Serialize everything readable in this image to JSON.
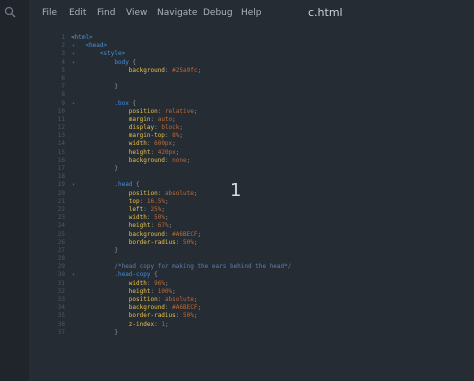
{
  "menu": {
    "file": "File",
    "edit": "Edit",
    "find": "Find",
    "view": "View",
    "navigate": "Navigate",
    "debug": "Debug",
    "help": "Help"
  },
  "document": {
    "title": "c.html"
  },
  "cursor_number": "1",
  "icons": {
    "sidebar": "search-icon"
  },
  "colors": {
    "background": "#262c33",
    "tag": "#4c8fd1",
    "property": "#e6c24a",
    "value": "#bf6a36"
  },
  "lines": [
    {
      "no": "1",
      "fold": "▾",
      "tokens": [
        {
          "c": "tag",
          "t": "<html>"
        }
      ]
    },
    {
      "no": "2",
      "fold": "▾",
      "tokens": [
        {
          "c": "pun",
          "t": "    "
        },
        {
          "c": "tag",
          "t": "<head>"
        }
      ]
    },
    {
      "no": "3",
      "fold": "▾",
      "tokens": [
        {
          "c": "pun",
          "t": "        "
        },
        {
          "c": "tag",
          "t": "<style>"
        }
      ]
    },
    {
      "no": "4",
      "fold": "▾",
      "tokens": [
        {
          "c": "pun",
          "t": "            "
        },
        {
          "c": "sel",
          "t": "body"
        },
        {
          "c": "pun",
          "t": " {"
        }
      ]
    },
    {
      "no": "5",
      "fold": "",
      "tokens": [
        {
          "c": "pun",
          "t": "                "
        },
        {
          "c": "prop",
          "t": "background"
        },
        {
          "c": "pun",
          "t": ": "
        },
        {
          "c": "val",
          "t": "#25a9fc"
        },
        {
          "c": "pun",
          "t": ";"
        }
      ]
    },
    {
      "no": "6",
      "fold": "",
      "tokens": [
        {
          "c": "pun",
          "t": ""
        }
      ]
    },
    {
      "no": "7",
      "fold": "",
      "tokens": [
        {
          "c": "pun",
          "t": "            }"
        }
      ]
    },
    {
      "no": "8",
      "fold": "",
      "tokens": [
        {
          "c": "pun",
          "t": ""
        }
      ]
    },
    {
      "no": "9",
      "fold": "▾",
      "tokens": [
        {
          "c": "pun",
          "t": "            "
        },
        {
          "c": "sel",
          "t": ".box"
        },
        {
          "c": "pun",
          "t": " {"
        }
      ]
    },
    {
      "no": "10",
      "fold": "",
      "tokens": [
        {
          "c": "pun",
          "t": "                "
        },
        {
          "c": "prop",
          "t": "position"
        },
        {
          "c": "pun",
          "t": ": "
        },
        {
          "c": "val",
          "t": "relative"
        },
        {
          "c": "pun",
          "t": ";"
        }
      ]
    },
    {
      "no": "11",
      "fold": "",
      "tokens": [
        {
          "c": "pun",
          "t": "                "
        },
        {
          "c": "prop",
          "t": "margin"
        },
        {
          "c": "pun",
          "t": ": "
        },
        {
          "c": "val",
          "t": "auto"
        },
        {
          "c": "pun",
          "t": ";"
        }
      ]
    },
    {
      "no": "12",
      "fold": "",
      "tokens": [
        {
          "c": "pun",
          "t": "                "
        },
        {
          "c": "prop",
          "t": "display"
        },
        {
          "c": "pun",
          "t": ": "
        },
        {
          "c": "val",
          "t": "block"
        },
        {
          "c": "pun",
          "t": ";"
        }
      ]
    },
    {
      "no": "13",
      "fold": "",
      "tokens": [
        {
          "c": "pun",
          "t": "                "
        },
        {
          "c": "prop",
          "t": "margin-top"
        },
        {
          "c": "pun",
          "t": ": "
        },
        {
          "c": "val",
          "t": "8%"
        },
        {
          "c": "pun",
          "t": ";"
        }
      ]
    },
    {
      "no": "14",
      "fold": "",
      "tokens": [
        {
          "c": "pun",
          "t": "                "
        },
        {
          "c": "prop",
          "t": "width"
        },
        {
          "c": "pun",
          "t": ": "
        },
        {
          "c": "val",
          "t": "600px"
        },
        {
          "c": "pun",
          "t": ";"
        }
      ]
    },
    {
      "no": "15",
      "fold": "",
      "tokens": [
        {
          "c": "pun",
          "t": "                "
        },
        {
          "c": "prop",
          "t": "height"
        },
        {
          "c": "pun",
          "t": ": "
        },
        {
          "c": "val",
          "t": "420px"
        },
        {
          "c": "pun",
          "t": ";"
        }
      ]
    },
    {
      "no": "16",
      "fold": "",
      "tokens": [
        {
          "c": "pun",
          "t": "                "
        },
        {
          "c": "prop",
          "t": "background"
        },
        {
          "c": "pun",
          "t": ": "
        },
        {
          "c": "val",
          "t": "none"
        },
        {
          "c": "pun",
          "t": ";"
        }
      ]
    },
    {
      "no": "17",
      "fold": "",
      "tokens": [
        {
          "c": "pun",
          "t": "            }"
        }
      ]
    },
    {
      "no": "18",
      "fold": "",
      "tokens": [
        {
          "c": "pun",
          "t": ""
        }
      ]
    },
    {
      "no": "19",
      "fold": "▾",
      "tokens": [
        {
          "c": "pun",
          "t": "            "
        },
        {
          "c": "sel",
          "t": ".head"
        },
        {
          "c": "pun",
          "t": " {"
        }
      ]
    },
    {
      "no": "20",
      "fold": "",
      "tokens": [
        {
          "c": "pun",
          "t": "                "
        },
        {
          "c": "prop",
          "t": "position"
        },
        {
          "c": "pun",
          "t": ": "
        },
        {
          "c": "val",
          "t": "absolute"
        },
        {
          "c": "pun",
          "t": ";"
        }
      ]
    },
    {
      "no": "21",
      "fold": "",
      "tokens": [
        {
          "c": "pun",
          "t": "                "
        },
        {
          "c": "prop",
          "t": "top"
        },
        {
          "c": "pun",
          "t": ": "
        },
        {
          "c": "val",
          "t": "16.5%"
        },
        {
          "c": "pun",
          "t": ";"
        }
      ]
    },
    {
      "no": "22",
      "fold": "",
      "tokens": [
        {
          "c": "pun",
          "t": "                "
        },
        {
          "c": "prop",
          "t": "left"
        },
        {
          "c": "pun",
          "t": ": "
        },
        {
          "c": "val",
          "t": "25%"
        },
        {
          "c": "pun",
          "t": ";"
        }
      ]
    },
    {
      "no": "23",
      "fold": "",
      "tokens": [
        {
          "c": "pun",
          "t": "                "
        },
        {
          "c": "prop",
          "t": "width"
        },
        {
          "c": "pun",
          "t": ": "
        },
        {
          "c": "val",
          "t": "50%"
        },
        {
          "c": "pun",
          "t": ";"
        }
      ]
    },
    {
      "no": "24",
      "fold": "",
      "tokens": [
        {
          "c": "pun",
          "t": "                "
        },
        {
          "c": "prop",
          "t": "height"
        },
        {
          "c": "pun",
          "t": ": "
        },
        {
          "c": "val",
          "t": "67%"
        },
        {
          "c": "pun",
          "t": ";"
        }
      ]
    },
    {
      "no": "25",
      "fold": "",
      "tokens": [
        {
          "c": "pun",
          "t": "                "
        },
        {
          "c": "prop",
          "t": "background"
        },
        {
          "c": "pun",
          "t": ": "
        },
        {
          "c": "val",
          "t": "#A6BECF"
        },
        {
          "c": "pun",
          "t": ";"
        }
      ]
    },
    {
      "no": "26",
      "fold": "",
      "tokens": [
        {
          "c": "pun",
          "t": "                "
        },
        {
          "c": "prop",
          "t": "border-radius"
        },
        {
          "c": "pun",
          "t": ": "
        },
        {
          "c": "val",
          "t": "50%"
        },
        {
          "c": "pun",
          "t": ";"
        }
      ]
    },
    {
      "no": "27",
      "fold": "",
      "tokens": [
        {
          "c": "pun",
          "t": "            }"
        }
      ]
    },
    {
      "no": "28",
      "fold": "",
      "tokens": [
        {
          "c": "pun",
          "t": ""
        }
      ]
    },
    {
      "no": "29",
      "fold": "",
      "tokens": [
        {
          "c": "pun",
          "t": "            "
        },
        {
          "c": "com",
          "t": "/*head copy for making the ears behind the head*/"
        }
      ]
    },
    {
      "no": "30",
      "fold": "▾",
      "tokens": [
        {
          "c": "pun",
          "t": "            "
        },
        {
          "c": "sel",
          "t": ".head-copy"
        },
        {
          "c": "pun",
          "t": " {"
        }
      ]
    },
    {
      "no": "31",
      "fold": "",
      "tokens": [
        {
          "c": "pun",
          "t": "                "
        },
        {
          "c": "prop",
          "t": "width"
        },
        {
          "c": "pun",
          "t": ": "
        },
        {
          "c": "val",
          "t": "96%"
        },
        {
          "c": "pun",
          "t": ";"
        }
      ]
    },
    {
      "no": "32",
      "fold": "",
      "tokens": [
        {
          "c": "pun",
          "t": "                "
        },
        {
          "c": "prop",
          "t": "height"
        },
        {
          "c": "pun",
          "t": ": "
        },
        {
          "c": "val",
          "t": "100%"
        },
        {
          "c": "pun",
          "t": ";"
        }
      ]
    },
    {
      "no": "33",
      "fold": "",
      "tokens": [
        {
          "c": "pun",
          "t": "                "
        },
        {
          "c": "prop",
          "t": "position"
        },
        {
          "c": "pun",
          "t": ": "
        },
        {
          "c": "val",
          "t": "absolute"
        },
        {
          "c": "pun",
          "t": ";"
        }
      ]
    },
    {
      "no": "34",
      "fold": "",
      "tokens": [
        {
          "c": "pun",
          "t": "                "
        },
        {
          "c": "prop",
          "t": "background"
        },
        {
          "c": "pun",
          "t": ": "
        },
        {
          "c": "val",
          "t": "#A6BECF"
        },
        {
          "c": "pun",
          "t": ";"
        }
      ]
    },
    {
      "no": "35",
      "fold": "",
      "tokens": [
        {
          "c": "pun",
          "t": "                "
        },
        {
          "c": "prop",
          "t": "border-radius"
        },
        {
          "c": "pun",
          "t": ": "
        },
        {
          "c": "val",
          "t": "50%"
        },
        {
          "c": "pun",
          "t": ";"
        }
      ]
    },
    {
      "no": "36",
      "fold": "",
      "tokens": [
        {
          "c": "pun",
          "t": "                "
        },
        {
          "c": "prop",
          "t": "z-index"
        },
        {
          "c": "pun",
          "t": ": "
        },
        {
          "c": "val",
          "t": "1"
        },
        {
          "c": "pun",
          "t": ";"
        }
      ]
    },
    {
      "no": "37",
      "fold": "",
      "tokens": [
        {
          "c": "pun",
          "t": "            }"
        }
      ]
    }
  ]
}
